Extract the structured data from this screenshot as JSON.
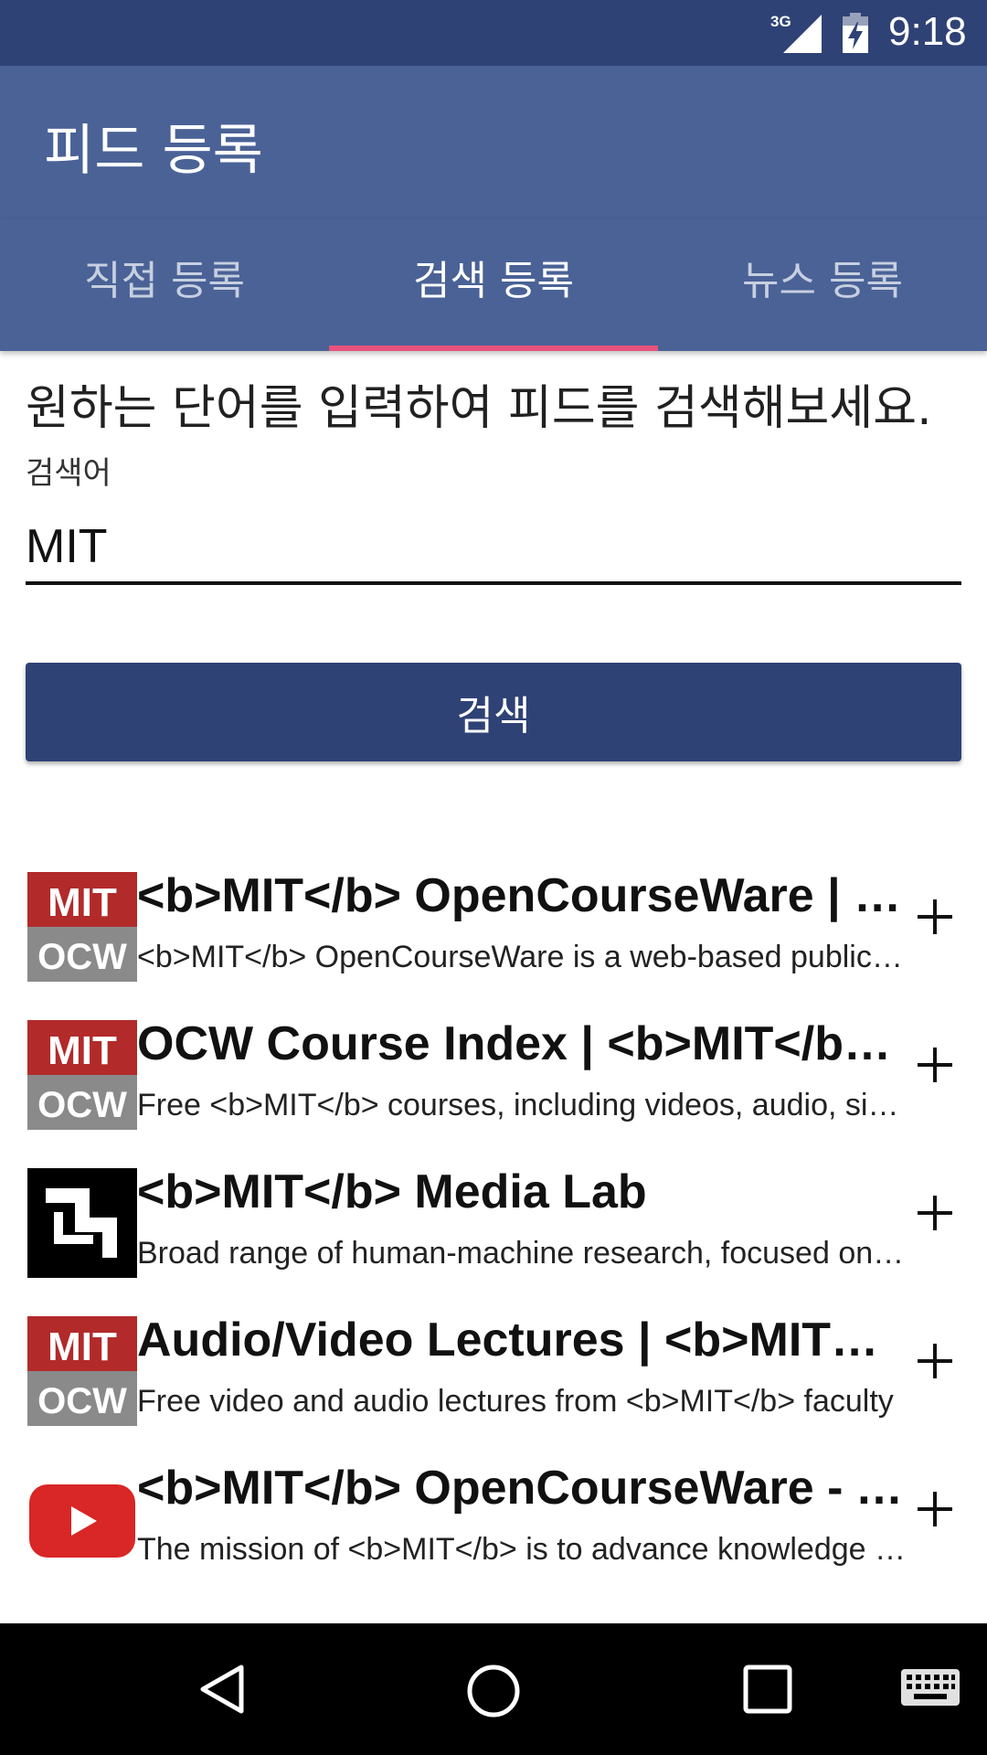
{
  "status_bar": {
    "network": "3G",
    "time": "9:18"
  },
  "app_bar": {
    "title": "피드 등록"
  },
  "tabs": [
    {
      "label": "직접 등록",
      "active": false
    },
    {
      "label": "검색 등록",
      "active": true
    },
    {
      "label": "뉴스 등록",
      "active": false
    }
  ],
  "instruction": "원하는 단어를 입력하여 피드를 검색해보세요.",
  "search": {
    "label": "검색어",
    "value": "MIT",
    "button_label": "검색"
  },
  "results": [
    {
      "icon": "mit-ocw-logo",
      "title": "<b>MIT</b> OpenCourseWare | Free Online Course Materials",
      "description": "<b>MIT</b> OpenCourseWare is a web-based publication of virtually all MIT course content"
    },
    {
      "icon": "mit-ocw-logo",
      "title": "OCW Course Index | <b>MIT</b> OpenCourseWare",
      "description": "Free <b>MIT</b> courses, including videos, audio, simulations, lecture notes"
    },
    {
      "icon": "media-lab-logo",
      "title": "<b>MIT</b> Media Lab",
      "description": "Broad range of human-machine research, focused on technology"
    },
    {
      "icon": "mit-ocw-logo",
      "title": "Audio/Video Lectures | <b>MIT</b> OpenCourseWare",
      "description": "Free video and audio lectures from <b>MIT</b> faculty"
    },
    {
      "icon": "youtube-logo",
      "title": "<b>MIT</b> OpenCourseWare - YouTube",
      "description": "The mission of <b>MIT</b> is to advance knowledge and educate students"
    }
  ],
  "colors": {
    "primary_dark": "#2f4275",
    "primary": "#4a6296",
    "accent": "#e8527d"
  },
  "nav_bar": {
    "icons": [
      "back-icon",
      "home-icon",
      "recents-icon",
      "keyboard-icon"
    ]
  }
}
